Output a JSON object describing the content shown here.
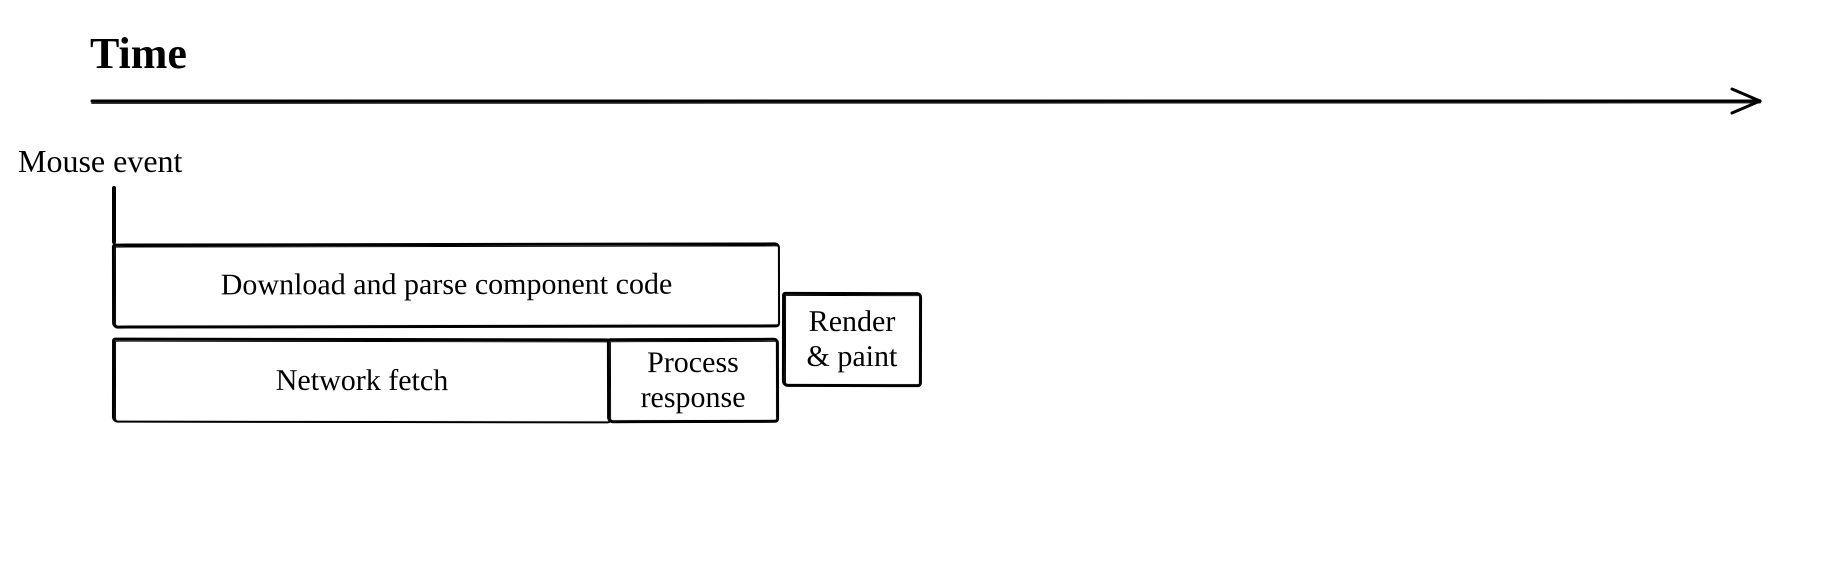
{
  "title": "Time",
  "event_label": "Mouse event",
  "boxes": {
    "download": "Download and parse component code",
    "network": "Network fetch",
    "process1": "Process",
    "process2": "response",
    "render1": "Render",
    "render2": "& paint"
  },
  "chart_data": {
    "type": "table",
    "title": "Time",
    "xlabel": "Time",
    "ylabel": "",
    "x_range": [
      0,
      100
    ],
    "rows": [
      {
        "row": "top",
        "label": "Download and parse component code",
        "start": 0,
        "end": 40
      },
      {
        "row": "bottom",
        "label": "Network fetch",
        "start": 0,
        "end": 30
      },
      {
        "row": "bottom",
        "label": "Process response",
        "start": 30,
        "end": 40
      },
      {
        "row": "merged",
        "label": "Render & paint",
        "start": 40,
        "end": 48
      }
    ],
    "event_marker": {
      "label": "Mouse event",
      "x": 0
    }
  }
}
